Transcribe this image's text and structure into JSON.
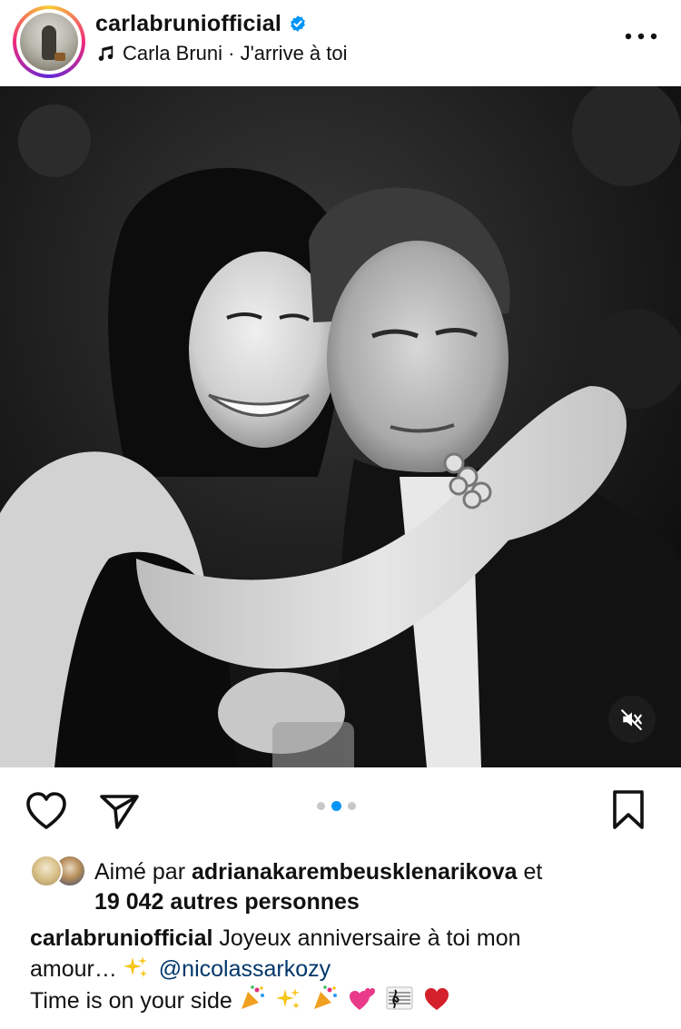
{
  "header": {
    "username": "carlabruniofficial",
    "verified": true,
    "music": "Carla Bruni · J'arrive à toi",
    "more_icon": "more-horizontal-icon"
  },
  "media": {
    "type": "black-and-white photo",
    "muted": true,
    "carousel": {
      "count": 3,
      "active_index": 1
    }
  },
  "actions": {
    "like_icon": "heart-outline-icon",
    "share_icon": "send-icon",
    "save_icon": "bookmark-outline-icon"
  },
  "likes": {
    "prefix": "Aimé par",
    "user": "adrianakarembeusklenarikova",
    "connector": "et",
    "others": "19 042 autres personnes"
  },
  "caption": {
    "username": "carlabruniofficial",
    "text_line1": "Joyeux anniversaire à toi mon",
    "text_line2": "amour…",
    "mention": "@nicolassarkozy",
    "text_line3": "Time is on your side"
  },
  "colors": {
    "verified_blue": "#0095f6",
    "carousel_active": "#0095f6",
    "mention": "#00376b",
    "heart_emoji": "#d4202a"
  }
}
